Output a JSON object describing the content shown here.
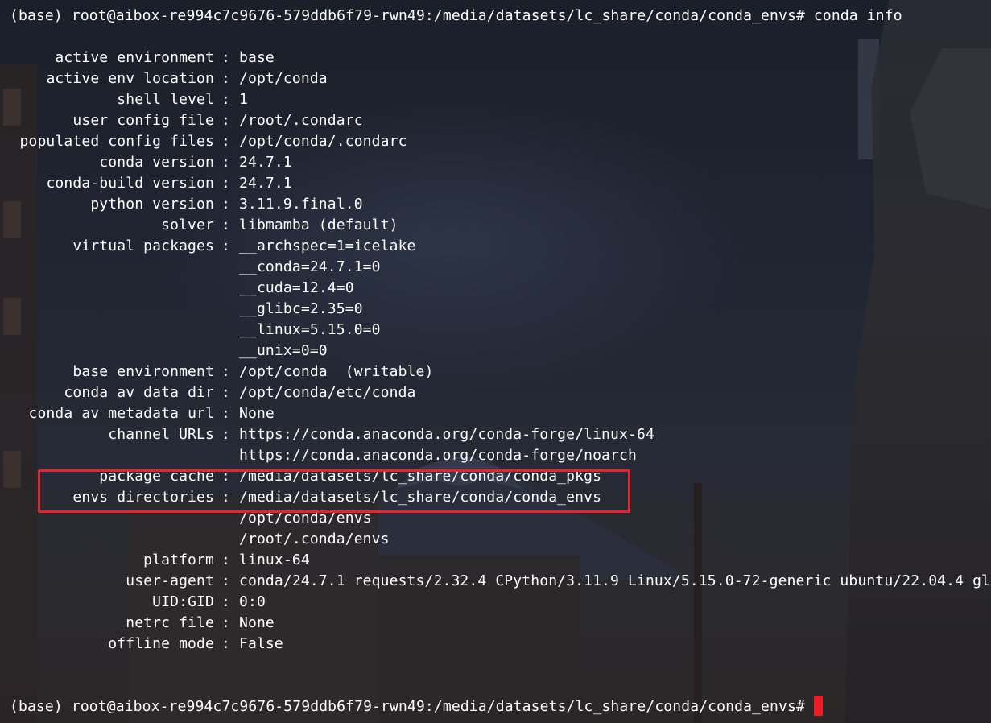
{
  "terminal": {
    "command_prompt": "(base) root@aibox-re994c7c9676-579ddb6f79-rwn49:/media/datasets/lc_share/conda/conda_envs# conda info",
    "final_prompt": "(base) root@aibox-re994c7c9676-579ddb6f79-rwn49:/media/datasets/lc_share/conda/conda_envs# ",
    "separator": ":",
    "cursor_color": "#ee1d25",
    "highlight_color": "#e8232b",
    "info": [
      {
        "key": "active environment",
        "value": "base"
      },
      {
        "key": "active env location",
        "value": "/opt/conda"
      },
      {
        "key": "shell level",
        "value": "1"
      },
      {
        "key": "user config file",
        "value": "/root/.condarc"
      },
      {
        "key": "populated config files",
        "value": "/opt/conda/.condarc"
      },
      {
        "key": "conda version",
        "value": "24.7.1"
      },
      {
        "key": "conda-build version",
        "value": "24.7.1"
      },
      {
        "key": "python version",
        "value": "3.11.9.final.0"
      },
      {
        "key": "solver",
        "value": "libmamba (default)"
      },
      {
        "key": "virtual packages",
        "value": "__archspec=1=icelake"
      },
      {
        "key": "",
        "value": "__conda=24.7.1=0"
      },
      {
        "key": "",
        "value": "__cuda=12.4=0"
      },
      {
        "key": "",
        "value": "__glibc=2.35=0"
      },
      {
        "key": "",
        "value": "__linux=5.15.0=0"
      },
      {
        "key": "",
        "value": "__unix=0=0"
      },
      {
        "key": "base environment",
        "value": "/opt/conda  (writable)"
      },
      {
        "key": "conda av data dir",
        "value": "/opt/conda/etc/conda"
      },
      {
        "key": "conda av metadata url",
        "value": "None"
      },
      {
        "key": "channel URLs",
        "value": "https://conda.anaconda.org/conda-forge/linux-64"
      },
      {
        "key": "",
        "value": "https://conda.anaconda.org/conda-forge/noarch"
      },
      {
        "key": "package cache",
        "value": "/media/datasets/lc_share/conda/conda_pkgs"
      },
      {
        "key": "envs directories",
        "value": "/media/datasets/lc_share/conda/conda_envs"
      },
      {
        "key": "",
        "value": "/opt/conda/envs"
      },
      {
        "key": "",
        "value": "/root/.conda/envs"
      },
      {
        "key": "platform",
        "value": "linux-64"
      },
      {
        "key": "user-agent",
        "value": "conda/24.7.1 requests/2.32.4 CPython/3.11.9 Linux/5.15.0-72-generic ubuntu/22.04.4 gl"
      },
      {
        "key": "UID:GID",
        "value": "0:0"
      },
      {
        "key": "netrc file",
        "value": "None"
      },
      {
        "key": "offline mode",
        "value": "False"
      }
    ]
  }
}
